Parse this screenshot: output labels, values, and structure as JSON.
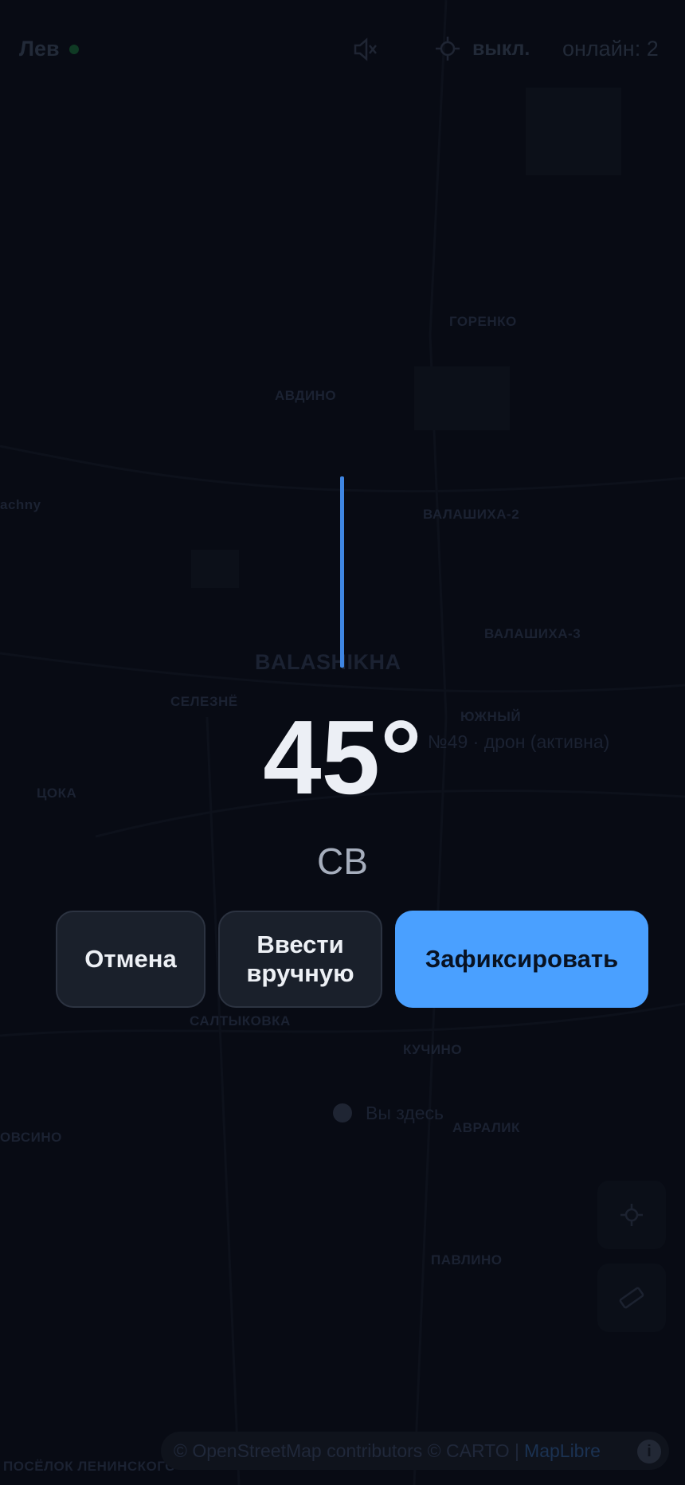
{
  "topbar": {
    "user_name": "Лев",
    "geo_status": "выкл.",
    "online_label": "онлайн: 2"
  },
  "map": {
    "labels": [
      "ГОРЕНКО",
      "АВДИНО",
      "ВАЛАШИХА-2",
      "BALASHIKHA",
      "ВАЛАШИХА-3",
      "ЮЖНЫЙ",
      "СЕЛЕЗНЁ",
      "ЦОКА",
      "САЛТЫКОВКА",
      "КУЧИНО",
      "ОВСИНО",
      "АВРАЛИК",
      "ПАВЛИНО",
      "ПОСЁЛОК ЛЕНИНСКОГО"
    ],
    "partial_label": "achny",
    "user_marker_label": "Вы здесь",
    "drone_label": "№49 · дрон (активна)"
  },
  "heading": {
    "degrees": "45°",
    "direction": "СВ"
  },
  "buttons": {
    "cancel": "Отмена",
    "manual": "Ввести вручную",
    "fix": "Зафиксировать"
  },
  "attribution": {
    "text": "© OpenStreetMap contributors © CARTO |",
    "maplibre": "MapLibre",
    "info": "i"
  },
  "colors": {
    "accent": "#4aa0ff",
    "needle": "#3f86e3",
    "background": "#080b14"
  }
}
